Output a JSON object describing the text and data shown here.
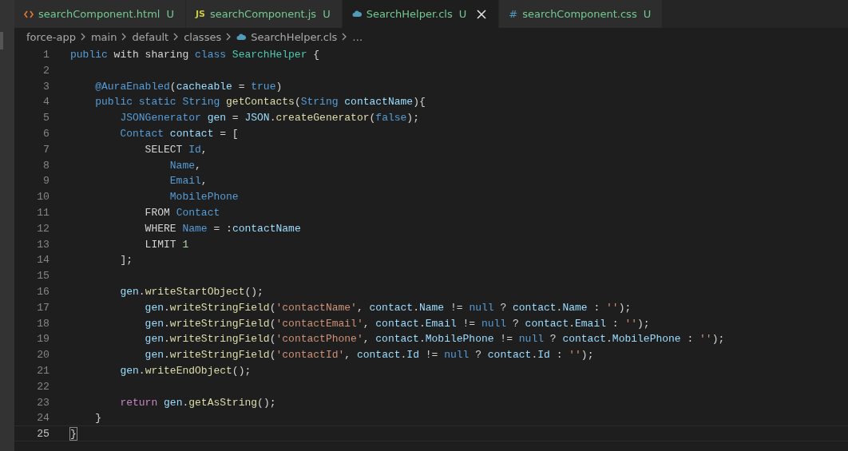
{
  "tabs": [
    {
      "label": "searchComponent.html",
      "kind": "html",
      "status": "U",
      "selected": false
    },
    {
      "label": "searchComponent.js",
      "kind": "js",
      "glyph": "JS",
      "status": "U",
      "selected": false
    },
    {
      "label": "SearchHelper.cls",
      "kind": "apex",
      "status": "U",
      "selected": true
    },
    {
      "label": "searchComponent.css",
      "kind": "css",
      "glyph": "#",
      "status": "U",
      "selected": false
    }
  ],
  "breadcrumb": [
    {
      "label": "force-app",
      "kind": "folder"
    },
    {
      "label": "main",
      "kind": "folder"
    },
    {
      "label": "default",
      "kind": "folder"
    },
    {
      "label": "classes",
      "kind": "folder"
    },
    {
      "label": "SearchHelper.cls",
      "kind": "apex"
    },
    {
      "label": "…",
      "kind": "more"
    }
  ],
  "editor": {
    "lines": [
      {
        "number": "1",
        "current": false,
        "tokens": [
          {
            "kind": "kw",
            "text": "public"
          },
          {
            "kind": "pl",
            "text": " with sharing "
          },
          {
            "kind": "kw",
            "text": "class "
          },
          {
            "kind": "ty",
            "text": "SearchHelper "
          },
          {
            "kind": "br",
            "text": "{"
          }
        ]
      },
      {
        "number": "2",
        "current": false
      },
      {
        "number": "3",
        "current": false,
        "tokens": [
          {
            "kind": "kw",
            "text": "    @AuraEnabled"
          },
          {
            "kind": "pl",
            "text": "("
          },
          {
            "kind": "va",
            "text": "cacheable"
          },
          {
            "kind": "pl",
            "text": " = "
          },
          {
            "kind": "kw",
            "text": "true"
          },
          {
            "kind": "pl",
            "text": ")"
          }
        ]
      },
      {
        "number": "4",
        "current": false,
        "tokens": [
          {
            "kind": "kw",
            "text": "    public static String "
          },
          {
            "kind": "fn",
            "text": "getContacts"
          },
          {
            "kind": "pl",
            "text": "("
          },
          {
            "kind": "kw",
            "text": "String "
          },
          {
            "kind": "va",
            "text": "contactName"
          },
          {
            "kind": "pl",
            "text": "){"
          }
        ]
      },
      {
        "number": "5",
        "current": false,
        "tokens": [
          {
            "kind": "kw",
            "text": "        JSONGenerator "
          },
          {
            "kind": "va",
            "text": "gen"
          },
          {
            "kind": "pl",
            "text": " = "
          },
          {
            "kind": "va",
            "text": "JSON"
          },
          {
            "kind": "pl",
            "text": "."
          },
          {
            "kind": "fn",
            "text": "createGenerator"
          },
          {
            "kind": "pl",
            "text": "("
          },
          {
            "kind": "kw",
            "text": "false"
          },
          {
            "kind": "pl",
            "text": ");"
          }
        ]
      },
      {
        "number": "6",
        "current": false,
        "tokens": [
          {
            "kind": "kw",
            "text": "        Contact "
          },
          {
            "kind": "va",
            "text": "contact"
          },
          {
            "kind": "pl",
            "text": " = ["
          }
        ]
      },
      {
        "number": "7",
        "current": false,
        "tokens": [
          {
            "kind": "pl",
            "text": "            SELECT "
          },
          {
            "kind": "kw",
            "text": "Id"
          },
          {
            "kind": "pl",
            "text": ","
          }
        ]
      },
      {
        "number": "8",
        "current": false,
        "tokens": [
          {
            "kind": "kw",
            "text": "                Name"
          },
          {
            "kind": "pl",
            "text": ","
          }
        ]
      },
      {
        "number": "9",
        "current": false,
        "tokens": [
          {
            "kind": "kw",
            "text": "                Email"
          },
          {
            "kind": "pl",
            "text": ","
          }
        ]
      },
      {
        "number": "10",
        "current": false,
        "tokens": [
          {
            "kind": "kw",
            "text": "                MobilePhone"
          }
        ]
      },
      {
        "number": "11",
        "current": false,
        "tokens": [
          {
            "kind": "pl",
            "text": "            FROM "
          },
          {
            "kind": "kw",
            "text": "Contact"
          }
        ]
      },
      {
        "number": "12",
        "current": false,
        "tokens": [
          {
            "kind": "pl",
            "text": "            WHERE "
          },
          {
            "kind": "kw",
            "text": "Name"
          },
          {
            "kind": "pl",
            "text": " = :"
          },
          {
            "kind": "va",
            "text": "contactName"
          }
        ]
      },
      {
        "number": "13",
        "current": false,
        "tokens": [
          {
            "kind": "pl",
            "text": "            LIMIT "
          },
          {
            "kind": "nu",
            "text": "1"
          }
        ]
      },
      {
        "number": "14",
        "current": false,
        "tokens": [
          {
            "kind": "pl",
            "text": "        ];"
          }
        ]
      },
      {
        "number": "15",
        "current": false
      },
      {
        "number": "16",
        "current": false,
        "tokens": [
          {
            "kind": "va",
            "text": "        gen"
          },
          {
            "kind": "pl",
            "text": "."
          },
          {
            "kind": "fn",
            "text": "writeStartObject"
          },
          {
            "kind": "pl",
            "text": "();"
          }
        ]
      },
      {
        "number": "17",
        "current": false,
        "tokens": [
          {
            "kind": "va",
            "text": "            gen"
          },
          {
            "kind": "pl",
            "text": "."
          },
          {
            "kind": "fn",
            "text": "writeStringField"
          },
          {
            "kind": "pl",
            "text": "("
          },
          {
            "kind": "st",
            "text": "'contactName'"
          },
          {
            "kind": "pl",
            "text": ", "
          },
          {
            "kind": "va",
            "text": "contact"
          },
          {
            "kind": "pl",
            "text": "."
          },
          {
            "kind": "va",
            "text": "Name"
          },
          {
            "kind": "pl",
            "text": " != "
          },
          {
            "kind": "kw",
            "text": "null"
          },
          {
            "kind": "pl",
            "text": " ? "
          },
          {
            "kind": "va",
            "text": "contact"
          },
          {
            "kind": "pl",
            "text": "."
          },
          {
            "kind": "va",
            "text": "Name"
          },
          {
            "kind": "pl",
            "text": " : "
          },
          {
            "kind": "st",
            "text": "''"
          },
          {
            "kind": "pl",
            "text": ");"
          }
        ]
      },
      {
        "number": "18",
        "current": false,
        "tokens": [
          {
            "kind": "va",
            "text": "            gen"
          },
          {
            "kind": "pl",
            "text": "."
          },
          {
            "kind": "fn",
            "text": "writeStringField"
          },
          {
            "kind": "pl",
            "text": "("
          },
          {
            "kind": "st",
            "text": "'contactEmail'"
          },
          {
            "kind": "pl",
            "text": ", "
          },
          {
            "kind": "va",
            "text": "contact"
          },
          {
            "kind": "pl",
            "text": "."
          },
          {
            "kind": "va",
            "text": "Email"
          },
          {
            "kind": "pl",
            "text": " != "
          },
          {
            "kind": "kw",
            "text": "null"
          },
          {
            "kind": "pl",
            "text": " ? "
          },
          {
            "kind": "va",
            "text": "contact"
          },
          {
            "kind": "pl",
            "text": "."
          },
          {
            "kind": "va",
            "text": "Email"
          },
          {
            "kind": "pl",
            "text": " : "
          },
          {
            "kind": "st",
            "text": "''"
          },
          {
            "kind": "pl",
            "text": ");"
          }
        ]
      },
      {
        "number": "19",
        "current": false,
        "tokens": [
          {
            "kind": "va",
            "text": "            gen"
          },
          {
            "kind": "pl",
            "text": "."
          },
          {
            "kind": "fn",
            "text": "writeStringField"
          },
          {
            "kind": "pl",
            "text": "("
          },
          {
            "kind": "st",
            "text": "'contactPhone'"
          },
          {
            "kind": "pl",
            "text": ", "
          },
          {
            "kind": "va",
            "text": "contact"
          },
          {
            "kind": "pl",
            "text": "."
          },
          {
            "kind": "va",
            "text": "MobilePhone"
          },
          {
            "kind": "pl",
            "text": " != "
          },
          {
            "kind": "kw",
            "text": "null"
          },
          {
            "kind": "pl",
            "text": " ? "
          },
          {
            "kind": "va",
            "text": "contact"
          },
          {
            "kind": "pl",
            "text": "."
          },
          {
            "kind": "va",
            "text": "MobilePhone"
          },
          {
            "kind": "pl",
            "text": " : "
          },
          {
            "kind": "st",
            "text": "''"
          },
          {
            "kind": "pl",
            "text": ");"
          }
        ]
      },
      {
        "number": "20",
        "current": false,
        "tokens": [
          {
            "kind": "va",
            "text": "            gen"
          },
          {
            "kind": "pl",
            "text": "."
          },
          {
            "kind": "fn",
            "text": "writeStringField"
          },
          {
            "kind": "pl",
            "text": "("
          },
          {
            "kind": "st",
            "text": "'contactId'"
          },
          {
            "kind": "pl",
            "text": ", "
          },
          {
            "kind": "va",
            "text": "contact"
          },
          {
            "kind": "pl",
            "text": "."
          },
          {
            "kind": "va",
            "text": "Id"
          },
          {
            "kind": "pl",
            "text": " != "
          },
          {
            "kind": "kw",
            "text": "null"
          },
          {
            "kind": "pl",
            "text": " ? "
          },
          {
            "kind": "va",
            "text": "contact"
          },
          {
            "kind": "pl",
            "text": "."
          },
          {
            "kind": "va",
            "text": "Id"
          },
          {
            "kind": "pl",
            "text": " : "
          },
          {
            "kind": "st",
            "text": "''"
          },
          {
            "kind": "pl",
            "text": ");"
          }
        ]
      },
      {
        "number": "21",
        "current": false,
        "tokens": [
          {
            "kind": "va",
            "text": "        gen"
          },
          {
            "kind": "pl",
            "text": "."
          },
          {
            "kind": "fn",
            "text": "writeEndObject"
          },
          {
            "kind": "pl",
            "text": "();"
          }
        ]
      },
      {
        "number": "22",
        "current": false
      },
      {
        "number": "23",
        "current": false,
        "tokens": [
          {
            "kind": "rt",
            "text": "        return "
          },
          {
            "kind": "va",
            "text": "gen"
          },
          {
            "kind": "pl",
            "text": "."
          },
          {
            "kind": "fn",
            "text": "getAsString"
          },
          {
            "kind": "pl",
            "text": "();"
          }
        ]
      },
      {
        "number": "24",
        "current": false,
        "tokens": [
          {
            "kind": "pl",
            "text": "    }"
          }
        ]
      },
      {
        "number": "25",
        "current": true,
        "tokens": [
          {
            "kind": "br",
            "text": "}"
          }
        ]
      }
    ]
  }
}
